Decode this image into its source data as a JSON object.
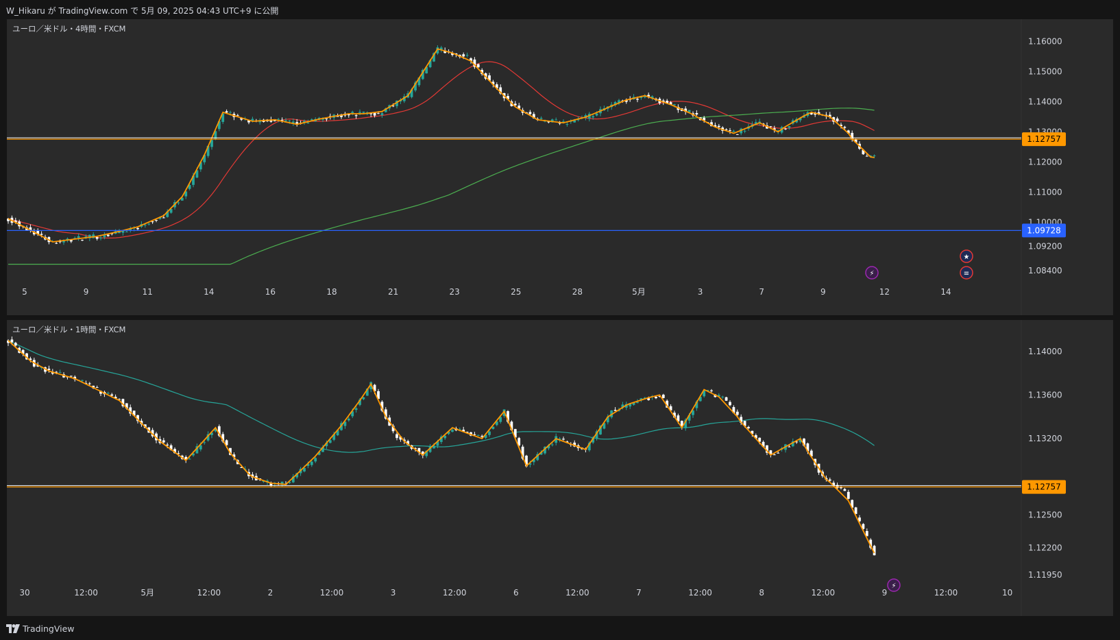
{
  "header": {
    "publish_text": "W_Hikaru が TradingView.com で 5月 09, 2025 04:43 UTC+9 に公開"
  },
  "footer": {
    "brand": "TradingView"
  },
  "colors": {
    "background": "#151515",
    "pane": "#2a2a2a",
    "candle_up": "#26a69a",
    "candle_down": "#ffffff",
    "zigzag": "#ff9800",
    "ma_red": "#e53935",
    "ma_green": "#4caf50",
    "ma_teal": "#26a69a",
    "hline_orange": "#ff9800",
    "hline_blue": "#2962ff",
    "hline_white": "#ffffff",
    "hline_green": "#00897b"
  },
  "panes": [
    {
      "title": "ユーロ／米ドル・4時間・FXCM",
      "price_ticks": [
        "1.16000",
        "1.15000",
        "1.14000",
        "1.13000",
        "1.12000",
        "1.11000",
        "1.10000",
        "1.09200",
        "1.08400"
      ],
      "price_tags": [
        {
          "label": "1.12757",
          "color": "#ff9800"
        },
        {
          "label": "1.09728",
          "color": "#2962ff"
        }
      ],
      "time_ticks": [
        "5",
        "9",
        "11",
        "14",
        "16",
        "18",
        "21",
        "23",
        "25",
        "28",
        "5月",
        "3",
        "7",
        "9",
        "12",
        "14"
      ],
      "event_icons": [
        "lightning-icon",
        "eu-flag-icon",
        "us-flag-icon"
      ],
      "chart_data": {
        "type": "candlestick",
        "title": "ユーロ／米ドル・4時間・FXCM",
        "instrument": "EUR/USD",
        "ylim": [
          1.081,
          1.166
        ],
        "x_tick_labels": [
          "5",
          "9",
          "11",
          "14",
          "16",
          "18",
          "21",
          "23",
          "25",
          "28",
          "5月",
          "3",
          "7",
          "9",
          "12",
          "14"
        ],
        "candle_count": 235,
        "candle_key_closes": [
          [
            0,
            1.1012
          ],
          [
            12,
            1.0935
          ],
          [
            25,
            1.0955
          ],
          [
            35,
            1.0985
          ],
          [
            42,
            1.1022
          ],
          [
            47,
            1.1085
          ],
          [
            52,
            1.1195
          ],
          [
            58,
            1.1365
          ],
          [
            66,
            1.1335
          ],
          [
            72,
            1.134
          ],
          [
            78,
            1.1325
          ],
          [
            85,
            1.1345
          ],
          [
            92,
            1.136
          ],
          [
            100,
            1.136
          ],
          [
            108,
            1.142
          ],
          [
            116,
            1.1575
          ],
          [
            124,
            1.1548
          ],
          [
            130,
            1.147
          ],
          [
            136,
            1.139
          ],
          [
            143,
            1.134
          ],
          [
            150,
            1.133
          ],
          [
            158,
            1.1355
          ],
          [
            165,
            1.14
          ],
          [
            172,
            1.142
          ],
          [
            178,
            1.1395
          ],
          [
            184,
            1.1365
          ],
          [
            190,
            1.132
          ],
          [
            196,
            1.1295
          ],
          [
            203,
            1.133
          ],
          [
            208,
            1.13
          ],
          [
            212,
            1.1335
          ],
          [
            217,
            1.1365
          ],
          [
            222,
            1.135
          ],
          [
            227,
            1.1295
          ],
          [
            231,
            1.122
          ],
          [
            234,
            1.1215
          ]
        ],
        "horizontal_lines": [
          1.12757,
          1.09728
        ],
        "series": [
          {
            "name": "",
            "type": "moving-average",
            "color": "#e53935"
          },
          {
            "name": "",
            "type": "moving-average",
            "color": "#4caf50"
          },
          {
            "name": "",
            "type": "zigzag",
            "color": "#ff9800"
          }
        ]
      }
    },
    {
      "title": "ユーロ／米ドル・1時間・FXCM",
      "price_ticks": [
        "1.14000",
        "1.13600",
        "1.13200",
        "1.12500",
        "1.12200",
        "1.11950"
      ],
      "price_tags": [
        {
          "label": "1.12757",
          "color": "#ff9800"
        }
      ],
      "time_ticks": [
        "30",
        "12:00",
        "5月",
        "12:00",
        "2",
        "12:00",
        "3",
        "12:00",
        "6",
        "12:00",
        "7",
        "12:00",
        "8",
        "12:00",
        "9",
        "12:00",
        "10"
      ],
      "event_icons": [
        "lightning-icon"
      ],
      "chart_data": {
        "type": "candlestick",
        "title": "ユーロ／米ドル・1時間・FXCM",
        "instrument": "EUR/USD",
        "ylim": [
          1.119,
          1.1425
        ],
        "x_tick_labels": [
          "30",
          "12:00",
          "5月",
          "12:00",
          "2",
          "12:00",
          "3",
          "12:00",
          "6",
          "12:00",
          "7",
          "12:00",
          "8",
          "12:00",
          "9",
          "12:00",
          "10"
        ],
        "candle_count": 235,
        "candle_key_closes": [
          [
            0,
            1.141
          ],
          [
            8,
            1.1385
          ],
          [
            18,
            1.1375
          ],
          [
            30,
            1.1355
          ],
          [
            40,
            1.132
          ],
          [
            48,
            1.13
          ],
          [
            56,
            1.133
          ],
          [
            62,
            1.1295
          ],
          [
            68,
            1.128
          ],
          [
            75,
            1.1278
          ],
          [
            82,
            1.13
          ],
          [
            92,
            1.134
          ],
          [
            98,
            1.137
          ],
          [
            104,
            1.1325
          ],
          [
            112,
            1.1305
          ],
          [
            120,
            1.133
          ],
          [
            128,
            1.132
          ],
          [
            134,
            1.1345
          ],
          [
            140,
            1.1295
          ],
          [
            148,
            1.132
          ],
          [
            156,
            1.131
          ],
          [
            163,
            1.1345
          ],
          [
            170,
            1.1355
          ],
          [
            176,
            1.136
          ],
          [
            182,
            1.133
          ],
          [
            188,
            1.1365
          ],
          [
            194,
            1.1355
          ],
          [
            198,
            1.1335
          ],
          [
            206,
            1.1305
          ],
          [
            214,
            1.132
          ],
          [
            220,
            1.1285
          ],
          [
            226,
            1.127
          ],
          [
            231,
            1.1235
          ],
          [
            234,
            1.1215
          ]
        ],
        "horizontal_lines": [
          1.12757
        ],
        "series": [
          {
            "name": "",
            "type": "moving-average",
            "color": "#26a69a"
          },
          {
            "name": "",
            "type": "zigzag",
            "color": "#ff9800"
          }
        ]
      }
    }
  ]
}
